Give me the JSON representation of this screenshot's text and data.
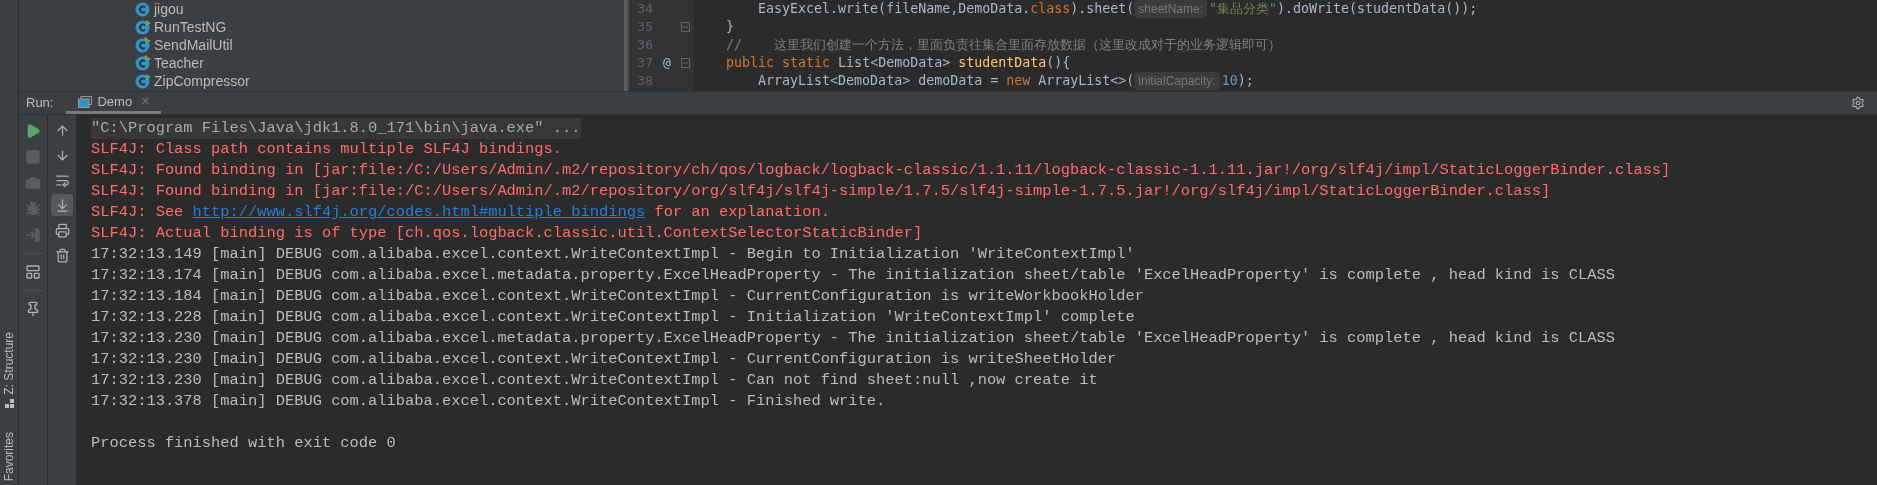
{
  "side_strip": {
    "tools": [
      {
        "label": "Z: Structure"
      },
      {
        "label": "Favorites"
      }
    ]
  },
  "project_tree": {
    "items": [
      {
        "label": "jigou",
        "kind": "class"
      },
      {
        "label": "RunTestNG",
        "kind": "runnable"
      },
      {
        "label": "SendMailUtil",
        "kind": "runnable_changed"
      },
      {
        "label": "Teacher",
        "kind": "runnable_changed"
      },
      {
        "label": "ZipCompressor",
        "kind": "runnable"
      }
    ]
  },
  "editor": {
    "lines": [
      {
        "number": "34",
        "fold": false,
        "tokens": [
          {
            "kind": "plain",
            "text": "        EasyExcel.write(fileName,DemoData."
          },
          {
            "kind": "keyword",
            "text": "class"
          },
          {
            "kind": "plain",
            "text": ").sheet("
          },
          {
            "kind": "hint",
            "text": "sheetName:"
          },
          {
            "kind": "string",
            "text": "\"集品分类\""
          },
          {
            "kind": "plain",
            "text": ").doWrite(studentData());"
          }
        ]
      },
      {
        "number": "35",
        "fold": true,
        "tokens": [
          {
            "kind": "plain",
            "text": "    }"
          }
        ]
      },
      {
        "number": "36",
        "fold": false,
        "tokens": [
          {
            "kind": "comment",
            "text": "    //    这里我们创建一个方法，里面负责往集合里面存放数据（这里改成对于的业务逻辑即可）"
          }
        ]
      },
      {
        "number": "37",
        "fold": true,
        "marker": "@",
        "tokens": [
          {
            "kind": "keyword",
            "text": "    public static "
          },
          {
            "kind": "plain",
            "text": "List<DemoData> "
          },
          {
            "kind": "method",
            "text": "studentData"
          },
          {
            "kind": "plain",
            "text": "(){"
          }
        ]
      },
      {
        "number": "38",
        "fold": false,
        "tokens": [
          {
            "kind": "plain",
            "text": "        ArrayList<DemoData> demoData = "
          },
          {
            "kind": "keyword",
            "text": "new "
          },
          {
            "kind": "plain",
            "text": "ArrayList<>("
          },
          {
            "kind": "hint",
            "text": "initialCapacity:"
          },
          {
            "kind": "number",
            "text": "10"
          },
          {
            "kind": "plain",
            "text": ");"
          }
        ]
      }
    ]
  },
  "run_panel": {
    "label": "Run:",
    "tabs": [
      {
        "label": "Demo",
        "close": "×",
        "selected": true
      }
    ],
    "toolbar_left": [
      {
        "kind": "run",
        "disabled": false
      },
      {
        "kind": "stop",
        "disabled": true
      },
      {
        "kind": "dump",
        "disabled": true
      },
      {
        "kind": "debug",
        "disabled": true
      },
      {
        "kind": "exit",
        "disabled": true
      },
      {
        "kind": "layout",
        "disabled": false
      },
      {
        "kind": "pin",
        "disabled": false
      }
    ],
    "toolbar_right": [
      {
        "kind": "up",
        "selected": false
      },
      {
        "kind": "down",
        "selected": false
      },
      {
        "kind": "wrap",
        "selected": false
      },
      {
        "kind": "scroll_end",
        "selected": true
      },
      {
        "kind": "print",
        "selected": false
      },
      {
        "kind": "clear",
        "selected": false
      }
    ],
    "console": [
      {
        "kind": "command",
        "segments": [
          {
            "kind": "text",
            "text": "\"C:\\Program Files\\Java\\jdk1.8.0_171\\bin\\java.exe\" ..."
          }
        ]
      },
      {
        "kind": "error",
        "segments": [
          {
            "kind": "text",
            "text": "SLF4J: Class path contains multiple SLF4J bindings."
          }
        ]
      },
      {
        "kind": "error",
        "segments": [
          {
            "kind": "text",
            "text": "SLF4J: Found binding in [jar:file:/C:/Users/Admin/.m2/repository/ch/qos/logback/logback-classic/1.1.11/logback-classic-1.1.11.jar!/org/slf4j/impl/StaticLoggerBinder.class]"
          }
        ]
      },
      {
        "kind": "error",
        "segments": [
          {
            "kind": "text",
            "text": "SLF4J: Found binding in [jar:file:/C:/Users/Admin/.m2/repository/org/slf4j/slf4j-simple/1.7.5/slf4j-simple-1.7.5.jar!/org/slf4j/impl/StaticLoggerBinder.class]"
          }
        ]
      },
      {
        "kind": "error",
        "segments": [
          {
            "kind": "text",
            "text": "SLF4J: See "
          },
          {
            "kind": "link",
            "text": "http://www.slf4j.org/codes.html#multiple_bindings"
          },
          {
            "kind": "text",
            "text": " for an explanation."
          }
        ]
      },
      {
        "kind": "error",
        "segments": [
          {
            "kind": "text",
            "text": "SLF4J: Actual binding is of type [ch.qos.logback.classic.util.ContextSelectorStaticBinder]"
          }
        ]
      },
      {
        "kind": "info",
        "segments": [
          {
            "kind": "text",
            "text": "17:32:13.149 [main] DEBUG com.alibaba.excel.context.WriteContextImpl - Begin to Initialization 'WriteContextImpl'"
          }
        ]
      },
      {
        "kind": "info",
        "segments": [
          {
            "kind": "text",
            "text": "17:32:13.174 [main] DEBUG com.alibaba.excel.metadata.property.ExcelHeadProperty - The initialization sheet/table 'ExcelHeadProperty' is complete , head kind is CLASS"
          }
        ]
      },
      {
        "kind": "info",
        "segments": [
          {
            "kind": "text",
            "text": "17:32:13.184 [main] DEBUG com.alibaba.excel.context.WriteContextImpl - CurrentConfiguration is writeWorkbookHolder"
          }
        ]
      },
      {
        "kind": "info",
        "segments": [
          {
            "kind": "text",
            "text": "17:32:13.228 [main] DEBUG com.alibaba.excel.context.WriteContextImpl - Initialization 'WriteContextImpl' complete"
          }
        ]
      },
      {
        "kind": "info",
        "segments": [
          {
            "kind": "text",
            "text": "17:32:13.230 [main] DEBUG com.alibaba.excel.metadata.property.ExcelHeadProperty - The initialization sheet/table 'ExcelHeadProperty' is complete , head kind is CLASS"
          }
        ]
      },
      {
        "kind": "info",
        "segments": [
          {
            "kind": "text",
            "text": "17:32:13.230 [main] DEBUG com.alibaba.excel.context.WriteContextImpl - CurrentConfiguration is writeSheetHolder"
          }
        ]
      },
      {
        "kind": "info",
        "segments": [
          {
            "kind": "text",
            "text": "17:32:13.230 [main] DEBUG com.alibaba.excel.context.WriteContextImpl - Can not find sheet:null ,now create it"
          }
        ]
      },
      {
        "kind": "info",
        "segments": [
          {
            "kind": "text",
            "text": "17:32:13.378 [main] DEBUG com.alibaba.excel.context.WriteContextImpl - Finished write."
          }
        ]
      },
      {
        "kind": "exit",
        "segments": [
          {
            "kind": "text",
            "text": "Process finished with exit code 0"
          }
        ]
      }
    ]
  }
}
